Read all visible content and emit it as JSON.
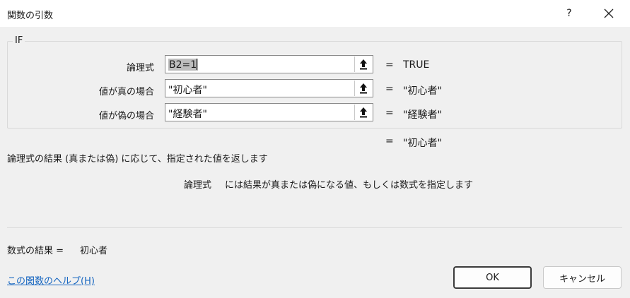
{
  "window": {
    "title": "関数の引数",
    "help": "?"
  },
  "function": {
    "name": "IF"
  },
  "args": [
    {
      "label": "論理式",
      "value": "B2=1",
      "result": "TRUE"
    },
    {
      "label": "値が真の場合",
      "value": "\"初心者\"",
      "result": "\"初心者\""
    },
    {
      "label": "値が偽の場合",
      "value": "\"経験者\"",
      "result": "\"経験者\""
    }
  ],
  "equals": "=",
  "overall_result": "\"初心者\"",
  "description": "論理式の結果 (真または偽) に応じて、指定された値を返します",
  "arg_help": {
    "name": "論理式",
    "text": "には結果が真または偽になる値、もしくは数式を指定します"
  },
  "formula_result": {
    "label": "数式の結果 =",
    "value": "初心者"
  },
  "help_link": "この関数のヘルプ(H)",
  "buttons": {
    "ok": "OK",
    "cancel": "キャンセル"
  },
  "icons": {
    "ref": "collapse-dialog-icon",
    "close": "close-icon"
  }
}
